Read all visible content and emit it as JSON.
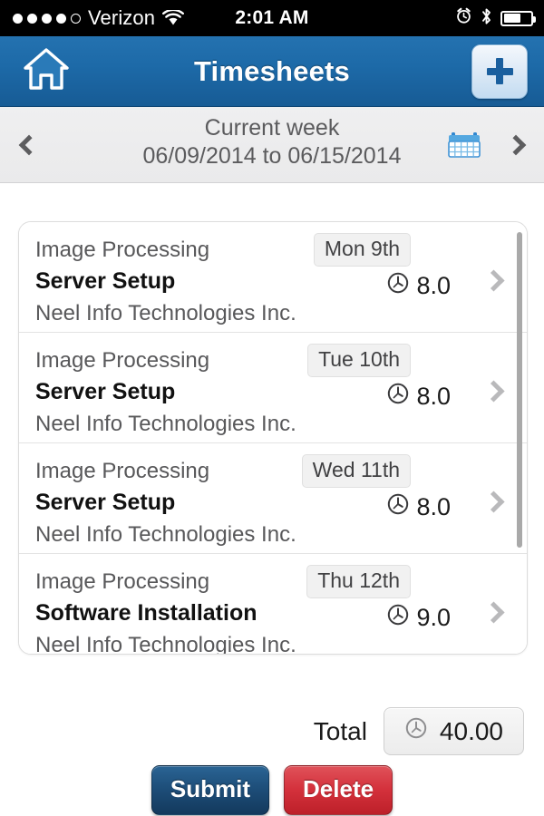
{
  "status_bar": {
    "signal_dots_total": 5,
    "signal_dots_filled": 4,
    "carrier": "Verizon",
    "wifi_icon": "wifi-icon",
    "time": "2:01 AM",
    "alarm_icon": "alarm-clock-icon",
    "bluetooth_icon": "bluetooth-icon",
    "battery_icon": "battery-icon"
  },
  "nav_bar": {
    "home_icon": "home-icon",
    "title": "Timesheets",
    "add_icon": "plus-icon",
    "background_color": "#1d6aa8"
  },
  "week_bar": {
    "prev_icon": "chevron-left-icon",
    "next_icon": "chevron-right-icon",
    "calendar_icon": "calendar-icon",
    "line1": "Current week",
    "line2": "06/09/2014 to 06/15/2014"
  },
  "timesheet_rows": [
    {
      "project": "Image Processing",
      "task": "Server Setup",
      "client": "Neel Info Technologies Inc.",
      "date": "Mon 9th",
      "hours": "8.0",
      "clock_icon": "clock-icon",
      "arrow_icon": "chevron-right-icon"
    },
    {
      "project": "Image Processing",
      "task": "Server Setup",
      "client": "Neel Info Technologies Inc.",
      "date": "Tue 10th",
      "hours": "8.0",
      "clock_icon": "clock-icon",
      "arrow_icon": "chevron-right-icon"
    },
    {
      "project": "Image Processing",
      "task": "Server Setup",
      "client": "Neel Info Technologies Inc.",
      "date": "Wed 11th",
      "hours": "8.0",
      "clock_icon": "clock-icon",
      "arrow_icon": "chevron-right-icon"
    },
    {
      "project": "Image Processing",
      "task": "Software Installation",
      "client": "Neel Info Technologies Inc.",
      "date": "Thu 12th",
      "hours": "9.0",
      "clock_icon": "clock-icon",
      "arrow_icon": "chevron-right-icon"
    }
  ],
  "total": {
    "label": "Total",
    "value": "40.00",
    "clock_icon": "clock-icon"
  },
  "actions": {
    "submit_label": "Submit",
    "submit_color": "#1d4d78",
    "delete_label": "Delete",
    "delete_color": "#d4313c"
  }
}
